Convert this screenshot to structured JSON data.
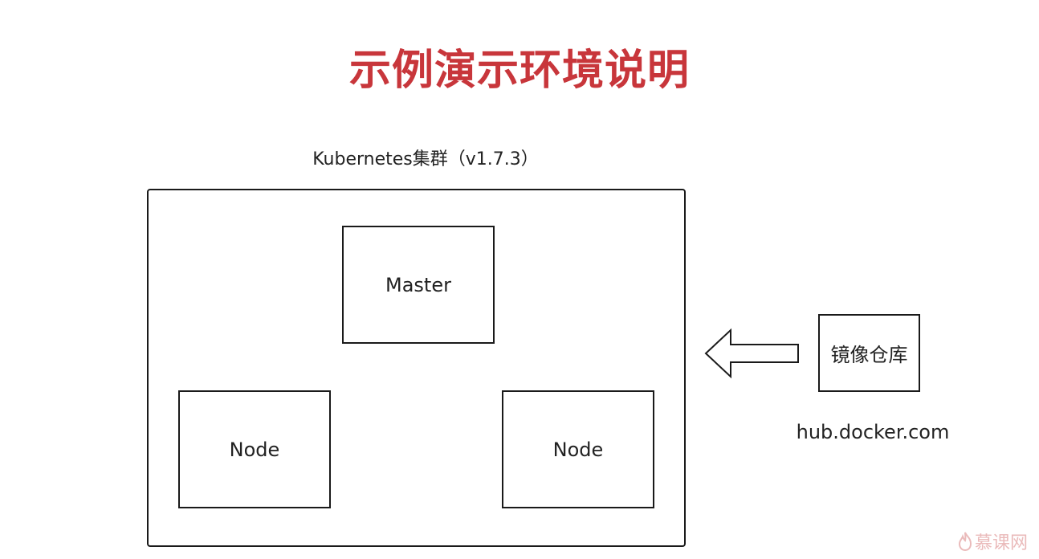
{
  "title": "示例演示环境说明",
  "cluster": {
    "label": "Kubernetes集群（v1.7.3）",
    "master_label": "Master",
    "node_labels": [
      "Node",
      "Node"
    ]
  },
  "registry": {
    "label": "镜像仓库",
    "url": "hub.docker.com"
  },
  "watermark": {
    "text": "慕课网",
    "icon": "flame-icon"
  },
  "colors": {
    "title": "#c8363b",
    "watermark": "#e8b3b3"
  }
}
